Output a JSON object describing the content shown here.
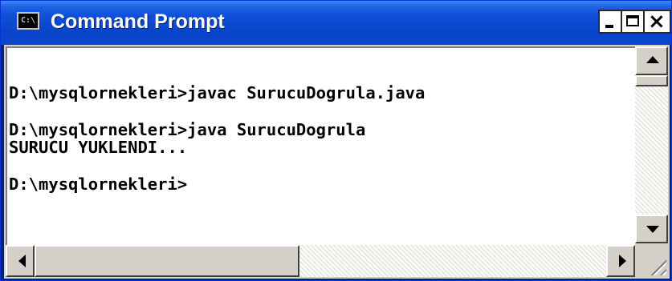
{
  "window": {
    "title": "Command Prompt",
    "icon_label": "C:\\",
    "buttons": {
      "minimize": "minimize-button",
      "maximize": "maximize-button",
      "close": "×"
    }
  },
  "console": {
    "lines": [
      "D:\\mysqlornekleri>javac SurucuDogrula.java",
      "",
      "D:\\mysqlornekleri>java SurucuDogrula",
      "SURUCU YUKLENDI...",
      "",
      "D:\\mysqlornekleri>"
    ]
  },
  "colors": {
    "titlebar": "#0a46ce",
    "console_background": "#ffffff",
    "console_text": "#000000",
    "frame": "#d4d0c8"
  }
}
